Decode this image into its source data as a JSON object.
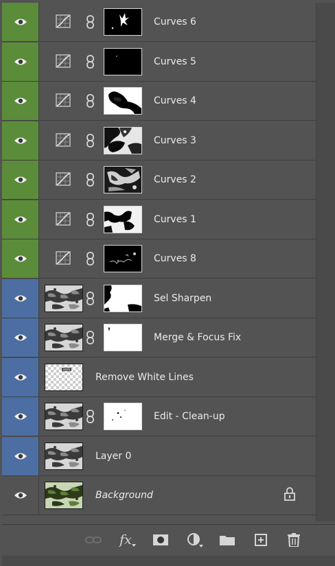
{
  "layers": [
    {
      "name": "Curves 6",
      "kind": "curves",
      "color": "green",
      "mask": "m1"
    },
    {
      "name": "Curves 5",
      "kind": "curves",
      "color": "green",
      "mask": "m2"
    },
    {
      "name": "Curves 4",
      "kind": "curves",
      "color": "green",
      "mask": "m3"
    },
    {
      "name": "Curves 3",
      "kind": "curves",
      "color": "green",
      "mask": "m4"
    },
    {
      "name": "Curves 2",
      "kind": "curves",
      "color": "green",
      "mask": "m5"
    },
    {
      "name": "Curves 1",
      "kind": "curves",
      "color": "green",
      "mask": "m6"
    },
    {
      "name": "Curves 8",
      "kind": "curves",
      "color": "green",
      "mask": "m7"
    },
    {
      "name": "Sel Sharpen",
      "kind": "masked",
      "color": "blue",
      "mask": "w1"
    },
    {
      "name": "Merge & Focus Fix",
      "kind": "masked",
      "color": "blue",
      "mask": "w2"
    },
    {
      "name": "Remove White Lines",
      "kind": "transparent",
      "color": "blue"
    },
    {
      "name": "Edit - Clean-up",
      "kind": "masked",
      "color": "blue",
      "mask": "w3"
    },
    {
      "name": "Layer 0",
      "kind": "plain",
      "color": "blue"
    },
    {
      "name": "Background",
      "kind": "background",
      "color": "none",
      "locked": true
    }
  ],
  "icons": {
    "visibility": "eye-icon",
    "adjustment": "curves-adjustment-icon",
    "link": "chain-link-icon",
    "lock": "lock-icon"
  },
  "footer_icons": [
    "link-layers-icon",
    "fx-icon",
    "add-mask-icon",
    "adjustment-layer-icon",
    "group-folder-icon",
    "new-layer-icon",
    "trash-icon"
  ],
  "footer": {
    "fx_label": "fx"
  },
  "colors": {
    "green_label": "#5b8c3a",
    "blue_label": "#4c6ea3",
    "panel": "#535353"
  }
}
